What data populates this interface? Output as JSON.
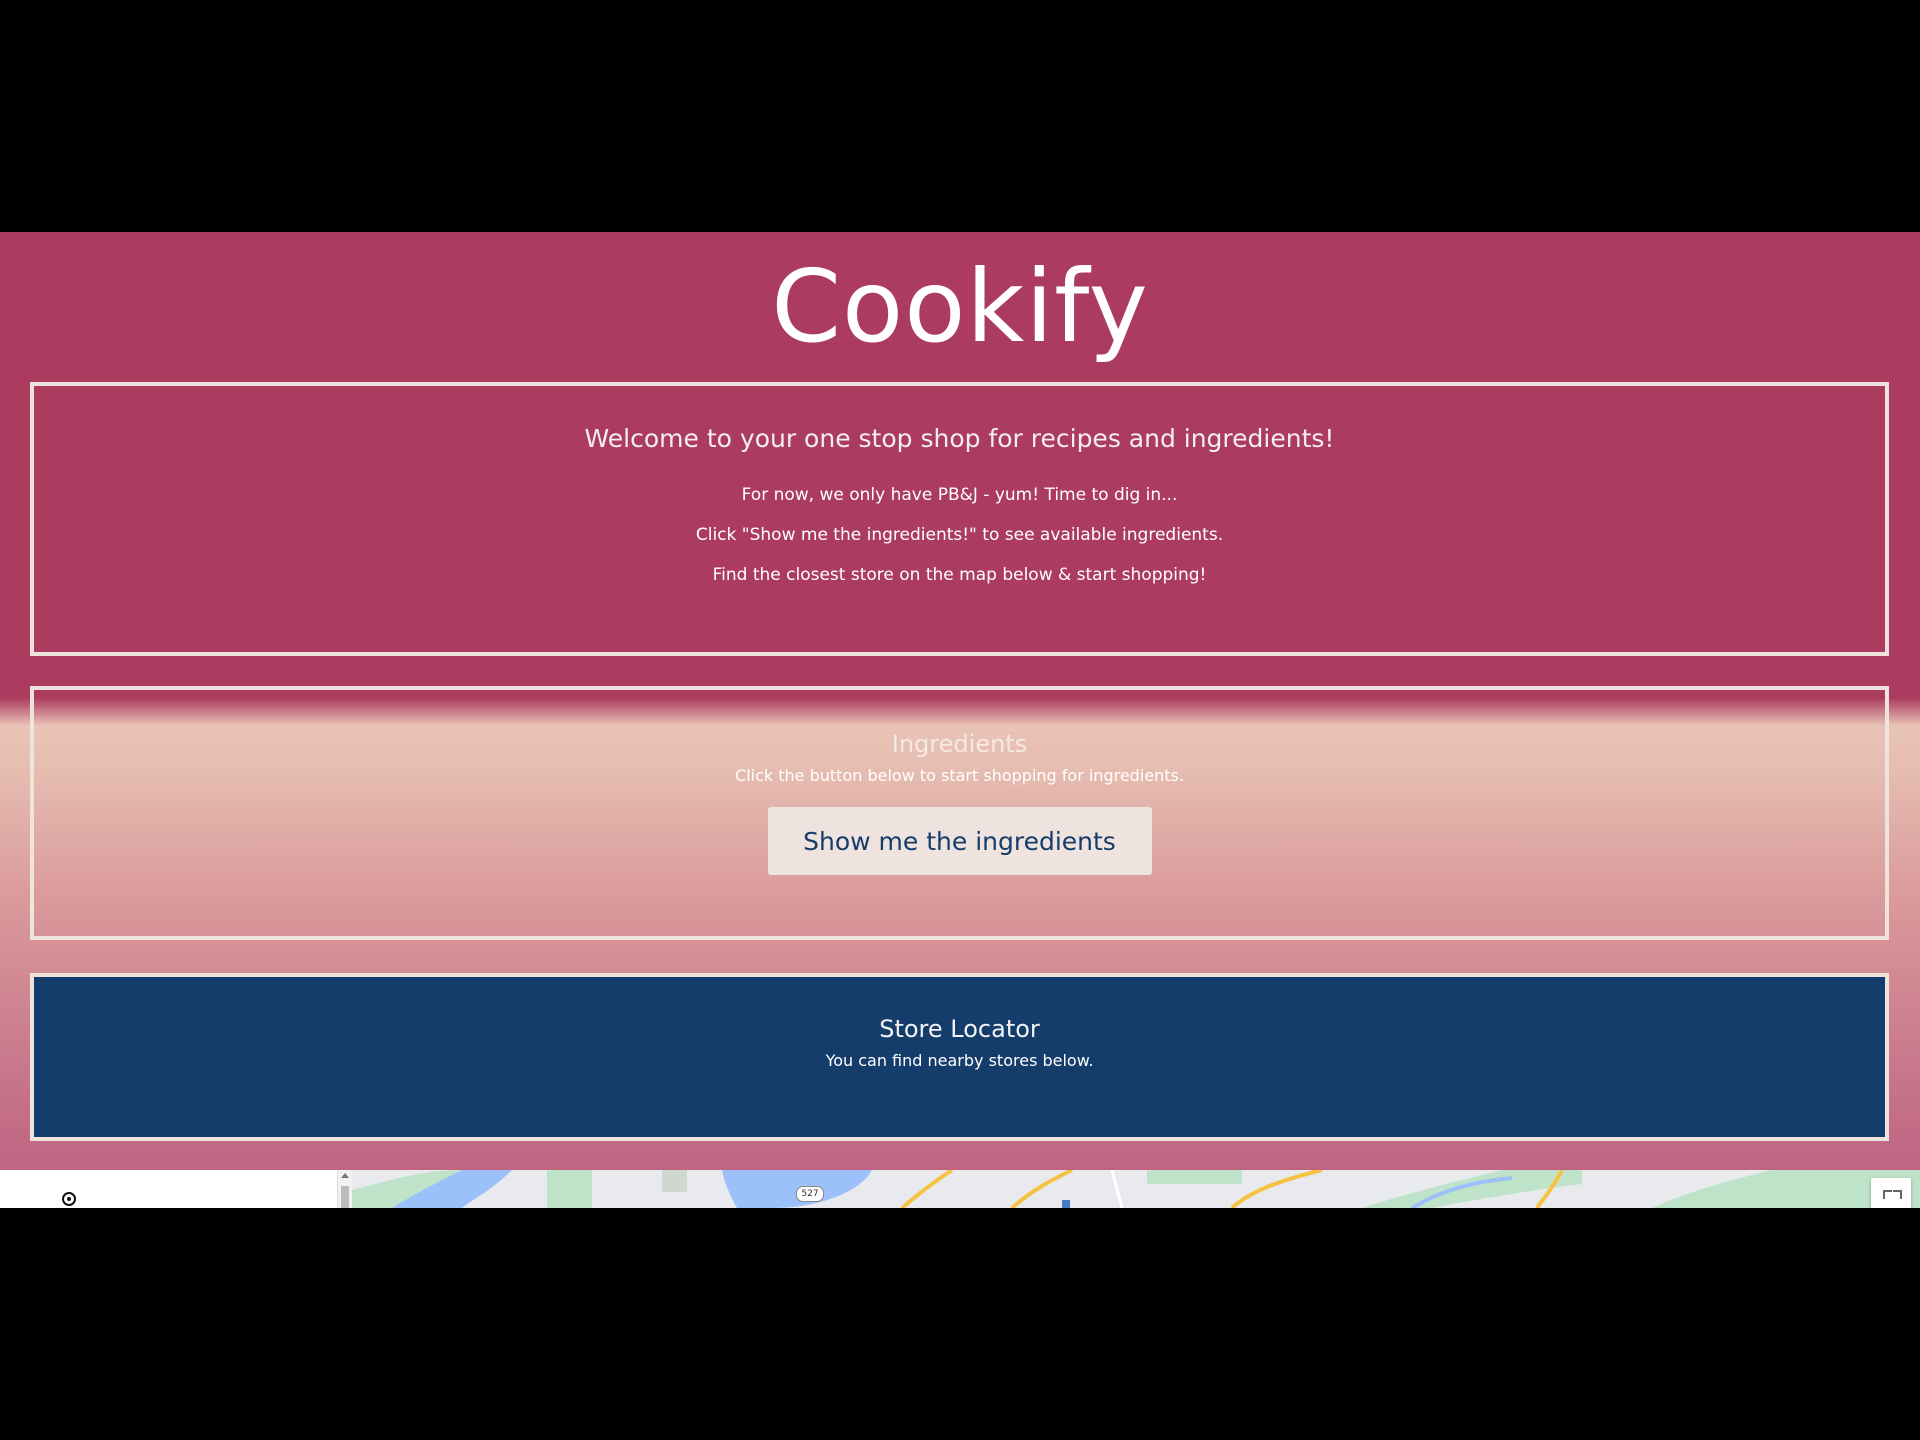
{
  "site": {
    "title": "Cookify"
  },
  "welcome": {
    "heading": "Welcome to your one stop shop for recipes and ingredients!",
    "lines": [
      "For now, we only have PB&J - yum! Time to dig in...",
      "Click \"Show me the ingredients!\" to see available ingredients.",
      "Find the closest store on the map below & start shopping!"
    ]
  },
  "ingredients": {
    "heading": "Ingredients",
    "subtext": "Click the button below to start shopping for ingredients.",
    "button_label": "Show me the ingredients"
  },
  "store_locator": {
    "heading": "Store Locator",
    "subtext": "You can find nearby stores below."
  },
  "map": {
    "route_badge": "527",
    "icons": [
      "my-location-icon",
      "fullscreen-icon"
    ]
  },
  "colors": {
    "brand_background": "#ab3c60",
    "panel_border": "#efe3de",
    "store_panel": "#143d6b",
    "button_background": "#efe3df",
    "button_text": "#143d6b"
  }
}
